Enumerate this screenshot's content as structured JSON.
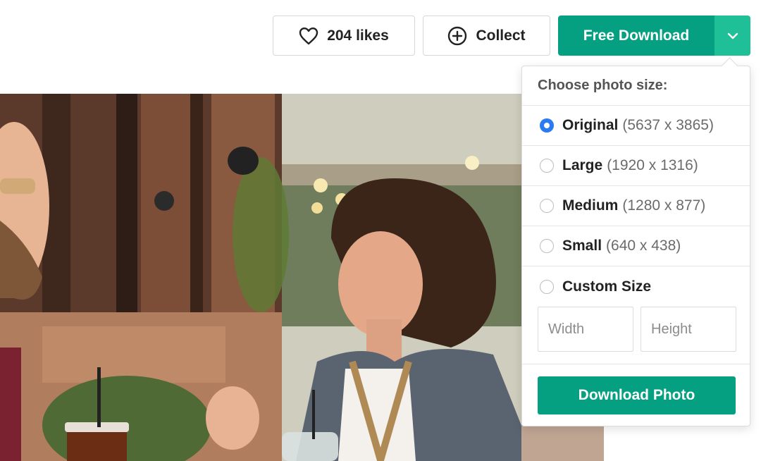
{
  "toolbar": {
    "likes_label": "204 likes",
    "collect_label": "Collect",
    "download_label": "Free Download",
    "like_icon": "heart-icon",
    "collect_icon": "plus-circle-icon",
    "toggle_icon": "chevron-down-icon"
  },
  "dropdown": {
    "title": "Choose photo size:",
    "options": [
      {
        "name": "Original",
        "dims": "(5637 x 3865)",
        "selected": true
      },
      {
        "name": "Large",
        "dims": "(1920 x 1316)",
        "selected": false
      },
      {
        "name": "Medium",
        "dims": "(1280 x 877)",
        "selected": false
      },
      {
        "name": "Small",
        "dims": "(640 x 438)",
        "selected": false
      }
    ],
    "custom": {
      "label": "Custom Size",
      "width_placeholder": "Width",
      "height_placeholder": "Height"
    },
    "download_button": "Download Photo"
  },
  "colors": {
    "primary_green": "#05a081",
    "toggle_green": "#1fbf97",
    "radio_selected": "#2a7bf0"
  }
}
